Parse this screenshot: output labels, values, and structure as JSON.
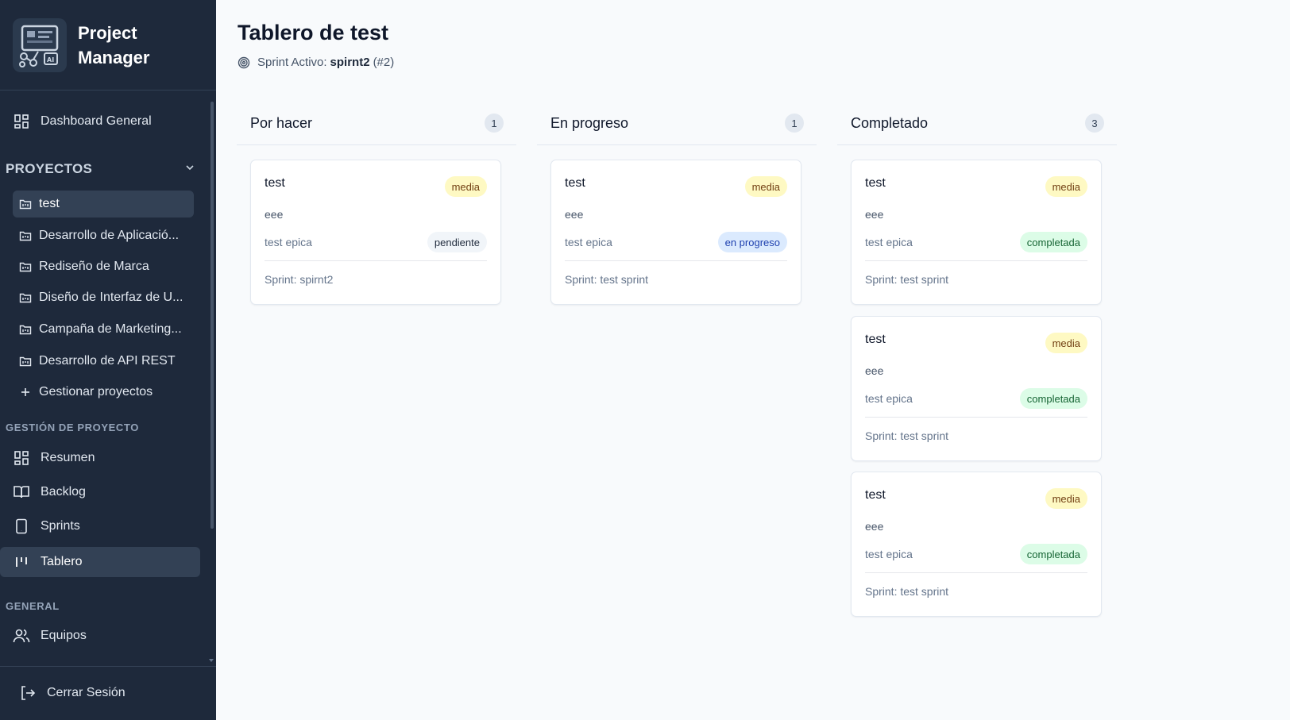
{
  "app": {
    "title_line1": "Project",
    "title_line2": "Manager"
  },
  "sidebar": {
    "dashboard_label": "Dashboard General",
    "projects_header": "PROYECTOS",
    "projects": [
      {
        "label": "test",
        "active": true
      },
      {
        "label": "Desarrollo de Aplicació..."
      },
      {
        "label": "Rediseño de Marca"
      },
      {
        "label": "Diseño de Interfaz de U..."
      },
      {
        "label": "Campaña de Marketing..."
      },
      {
        "label": "Desarrollo de API REST"
      }
    ],
    "manage_projects_label": "Gestionar proyectos",
    "project_mgmt_title": "GESTIÓN DE PROYECTO",
    "project_mgmt_items": [
      {
        "label": "Resumen",
        "icon": "grid-icon"
      },
      {
        "label": "Backlog",
        "icon": "book-icon"
      },
      {
        "label": "Sprints",
        "icon": "tablet-icon"
      },
      {
        "label": "Tablero",
        "icon": "kanban-icon",
        "active": true
      }
    ],
    "general_title": "GENERAL",
    "general_items": [
      {
        "label": "Equipos",
        "icon": "users-icon"
      }
    ],
    "logout_label": "Cerrar Sesión"
  },
  "header": {
    "title": "Tablero de test",
    "sprint_prefix": "Sprint Activo:",
    "sprint_name": "spirnt2",
    "sprint_number": "(#2)"
  },
  "board": {
    "columns": [
      {
        "title": "Por hacer",
        "count": "1",
        "cards": [
          {
            "title": "test",
            "priority": "media",
            "desc": "eee",
            "epic": "test epica",
            "status": "pendiente",
            "sprint": "Sprint: spirnt2"
          }
        ]
      },
      {
        "title": "En progreso",
        "count": "1",
        "cards": [
          {
            "title": "test",
            "priority": "media",
            "desc": "eee",
            "epic": "test epica",
            "status": "en progreso",
            "sprint": "Sprint: test sprint"
          }
        ]
      },
      {
        "title": "Completado",
        "count": "3",
        "cards": [
          {
            "title": "test",
            "priority": "media",
            "desc": "eee",
            "epic": "test epica",
            "status": "completada",
            "sprint": "Sprint: test sprint"
          },
          {
            "title": "test",
            "priority": "media",
            "desc": "eee",
            "epic": "test epica",
            "status": "completada",
            "sprint": "Sprint: test sprint"
          },
          {
            "title": "test",
            "priority": "media",
            "desc": "eee",
            "epic": "test epica",
            "status": "completada",
            "sprint": "Sprint: test sprint"
          }
        ]
      }
    ]
  },
  "colors": {
    "sidebar_bg": "#1e293b",
    "sidebar_active": "#334155",
    "priority_bg": "#fef9c3",
    "status_pending_bg": "#f1f5f9",
    "status_progress_bg": "#dbeafe",
    "status_done_bg": "#dcfce7"
  }
}
